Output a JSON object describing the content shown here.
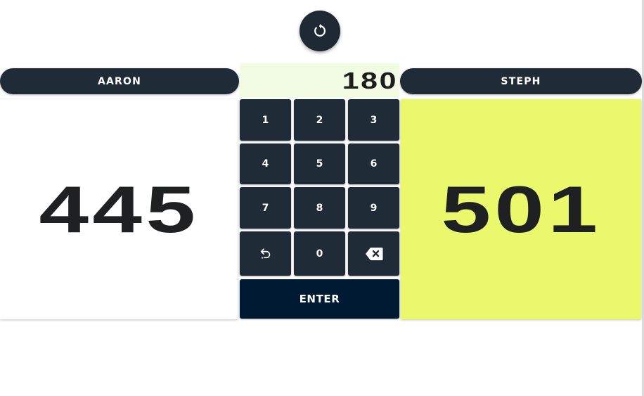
{
  "reset_button": {
    "icon": "refresh-icon"
  },
  "players": {
    "left": {
      "name": "AARON",
      "score": "445"
    },
    "right": {
      "name": "STEPH",
      "score": "501",
      "highlight_color": "#eaf86c"
    }
  },
  "keypad": {
    "display": "180",
    "keys": [
      "1",
      "2",
      "3",
      "4",
      "5",
      "6",
      "7",
      "8",
      "9"
    ],
    "zero": "0",
    "undo_icon": "undo-icon",
    "backspace_icon": "backspace-icon",
    "enter_label": "ENTER"
  },
  "colors": {
    "button_dark": "#1f2b36",
    "enter": "#011a33",
    "display_bg": "#f2fce3",
    "active_panel": "#eaf86c"
  }
}
